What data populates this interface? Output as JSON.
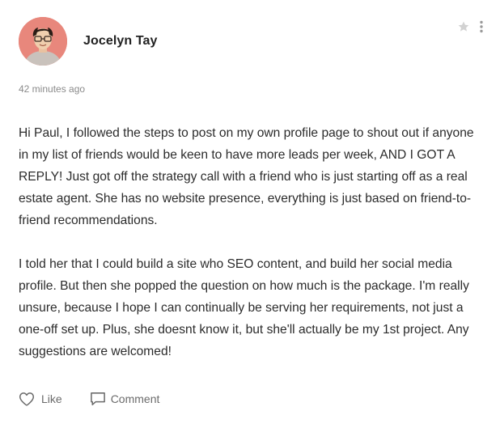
{
  "post": {
    "author_name": "Jocelyn Tay",
    "timestamp": "42 minutes ago",
    "paragraphs": [
      "Hi Paul, I followed the steps to post on my own profile page to shout out if anyone in my list of friends would be keen to have more leads per week, AND I GOT A REPLY! Just got off the strategy call with a friend who is just starting off as a real estate agent. She has no website presence, everything is just based on friend-to-friend recommendations.",
      "I told her that I could build a site who SEO content, and build her social media profile. But then she popped the question on how much is the package. I'm really unsure, because I hope I can continually be serving her requirements, not just a one-off set up. Plus, she doesnt know it, but she'll actually be my 1st project. Any suggestions are welcomed!"
    ]
  },
  "actions": {
    "like_label": "Like",
    "comment_label": "Comment"
  },
  "icons": {
    "star": "star-icon",
    "more": "more-vertical-icon",
    "like": "heart-icon",
    "comment": "comment-icon"
  },
  "colors": {
    "avatar_background": "#e8877c",
    "icon_muted": "#c8c8c8",
    "action_text": "#6b6b6b"
  }
}
